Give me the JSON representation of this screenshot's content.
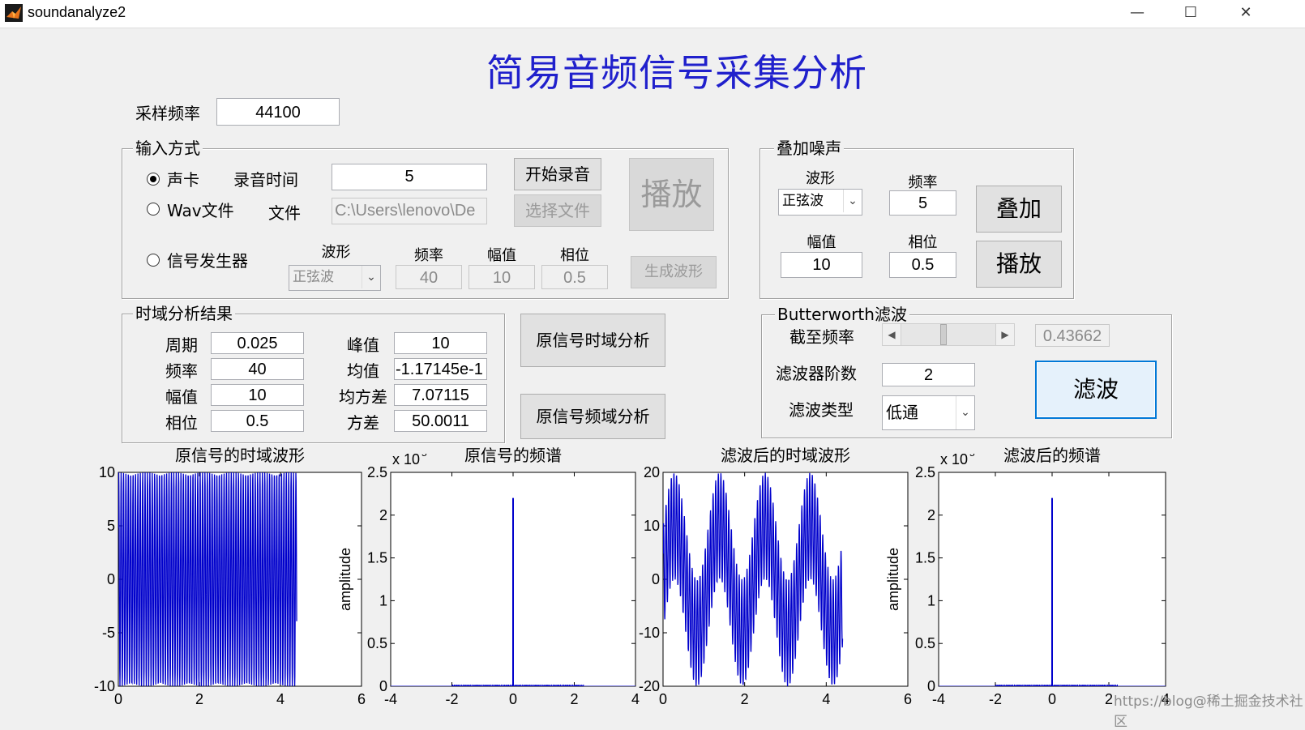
{
  "window": {
    "title": "soundanalyze2",
    "minimize": "—",
    "maximize": "☐",
    "close": "✕"
  },
  "app_title": "简易音频信号采集分析",
  "sampling": {
    "label": "采样频率",
    "value": "44100"
  },
  "input_panel": {
    "title": "输入方式",
    "radio_soundcard": "声卡",
    "radio_wav": "Wav文件",
    "radio_generator": "信号发生器",
    "rec_time_label": "录音时间",
    "rec_time_value": "5",
    "file_label": "文件",
    "file_value": "C:\\Users\\lenovo\\De",
    "start_record": "开始录音",
    "select_file": "选择文件",
    "play": "播放",
    "gen_wave_label": "波形",
    "gen_freq_label": "频率",
    "gen_amp_label": "幅值",
    "gen_phase_label": "相位",
    "gen_wave_value": "正弦波",
    "gen_freq_value": "40",
    "gen_amp_value": "10",
    "gen_phase_value": "0.5",
    "gen_button": "生成波形"
  },
  "noise_panel": {
    "title": "叠加噪声",
    "wave_label": "波形",
    "wave_value": "正弦波",
    "freq_label": "频率",
    "freq_value": "5",
    "amp_label": "幅值",
    "amp_value": "10",
    "phase_label": "相位",
    "phase_value": "0.5",
    "add_button": "叠加",
    "play_button": "播放"
  },
  "time_panel": {
    "title": "时域分析结果",
    "period_label": "周期",
    "period_value": "0.025",
    "freq_label": "频率",
    "freq_value": "40",
    "amp_label": "幅值",
    "amp_value": "10",
    "phase_label": "相位",
    "phase_value": "0.5",
    "peak_label": "峰值",
    "peak_value": "10",
    "mean_label": "均值",
    "mean_value": "-1.17145e-1",
    "std_label": "均方差",
    "std_value": "7.07115",
    "var_label": "方差",
    "var_value": "50.0011"
  },
  "analysis_buttons": {
    "time": "原信号时域分析",
    "freq": "原信号频域分析"
  },
  "filter_panel": {
    "title": "Butterworth滤波",
    "cutoff_label": "截至频率",
    "cutoff_value": "0.43662",
    "cutoff_fraction": 0.43662,
    "order_label": "滤波器阶数",
    "order_value": "2",
    "type_label": "滤波类型",
    "type_value": "低通",
    "filter_button": "滤波"
  },
  "plots": {
    "p1": {
      "title": "原信号的时域波形",
      "yticks": [
        "10",
        "5",
        "0",
        "-5",
        "-10"
      ],
      "xticks": [
        "0",
        "2",
        "4",
        "6"
      ]
    },
    "p2": {
      "title": "原信号的频谱",
      "ylabel": "amplitude",
      "exp_x": "x 10",
      "exp_sup": "5",
      "yticks": [
        "2.5",
        "2",
        "1.5",
        "1",
        "0.5",
        "0"
      ],
      "xticks": [
        "-4",
        "-2",
        "0",
        "2",
        "4"
      ]
    },
    "p3": {
      "title": "滤波后的时域波形",
      "yticks": [
        "20",
        "10",
        "0",
        "-10",
        "-20"
      ],
      "xticks": [
        "0",
        "2",
        "4",
        "6"
      ]
    },
    "p4": {
      "title": "滤波后的频谱",
      "ylabel": "amplitude",
      "exp_x": "x 10",
      "exp_sup": "5",
      "yticks": [
        "2.5",
        "2",
        "1.5",
        "1",
        "0.5",
        "0"
      ],
      "xticks": [
        "-4",
        "-2",
        "0",
        "2",
        "4"
      ]
    }
  },
  "watermark": "https://blog@稀土掘金技术社区",
  "colors": {
    "title_blue": "#2020cc",
    "plot_line": "#0000cc",
    "filter_button_bg": "#e5f1fb"
  },
  "chart_data": [
    {
      "type": "line",
      "title": "原信号的时域波形",
      "xlim": [
        0,
        6
      ],
      "ylim": [
        -10,
        10
      ],
      "series": [
        {
          "signal": "10*sin(2*pi*40*t+0.5)",
          "x_range": [
            0,
            4.4
          ],
          "amplitude": 10
        }
      ]
    },
    {
      "type": "bar",
      "title": "原信号的频谱",
      "ylabel": "amplitude",
      "xlim": [
        -4,
        4
      ],
      "ylim": [
        0,
        2.5
      ],
      "y_exponent": 5,
      "peaks": [
        {
          "x": 0,
          "y": 2.2
        }
      ],
      "noise_floor": {
        "x_range": [
          -2,
          2.3
        ],
        "y": 0.02
      }
    },
    {
      "type": "line",
      "title": "滤波后的时域波形",
      "xlim": [
        0,
        6
      ],
      "ylim": [
        -20,
        20
      ],
      "series": [
        {
          "x_range": [
            0,
            4.4
          ],
          "components": [
            {
              "amplitude": 10,
              "freq": 40
            },
            {
              "amplitude": 10,
              "freq": 5
            }
          ]
        }
      ]
    },
    {
      "type": "bar",
      "title": "滤波后的频谱",
      "ylabel": "amplitude",
      "xlim": [
        -4,
        4
      ],
      "ylim": [
        0,
        2.5
      ],
      "y_exponent": 5,
      "peaks": [
        {
          "x": 0,
          "y": 2.2
        }
      ],
      "noise_floor": {
        "x_range": [
          -2,
          2.3
        ],
        "y": 0.02
      }
    }
  ]
}
